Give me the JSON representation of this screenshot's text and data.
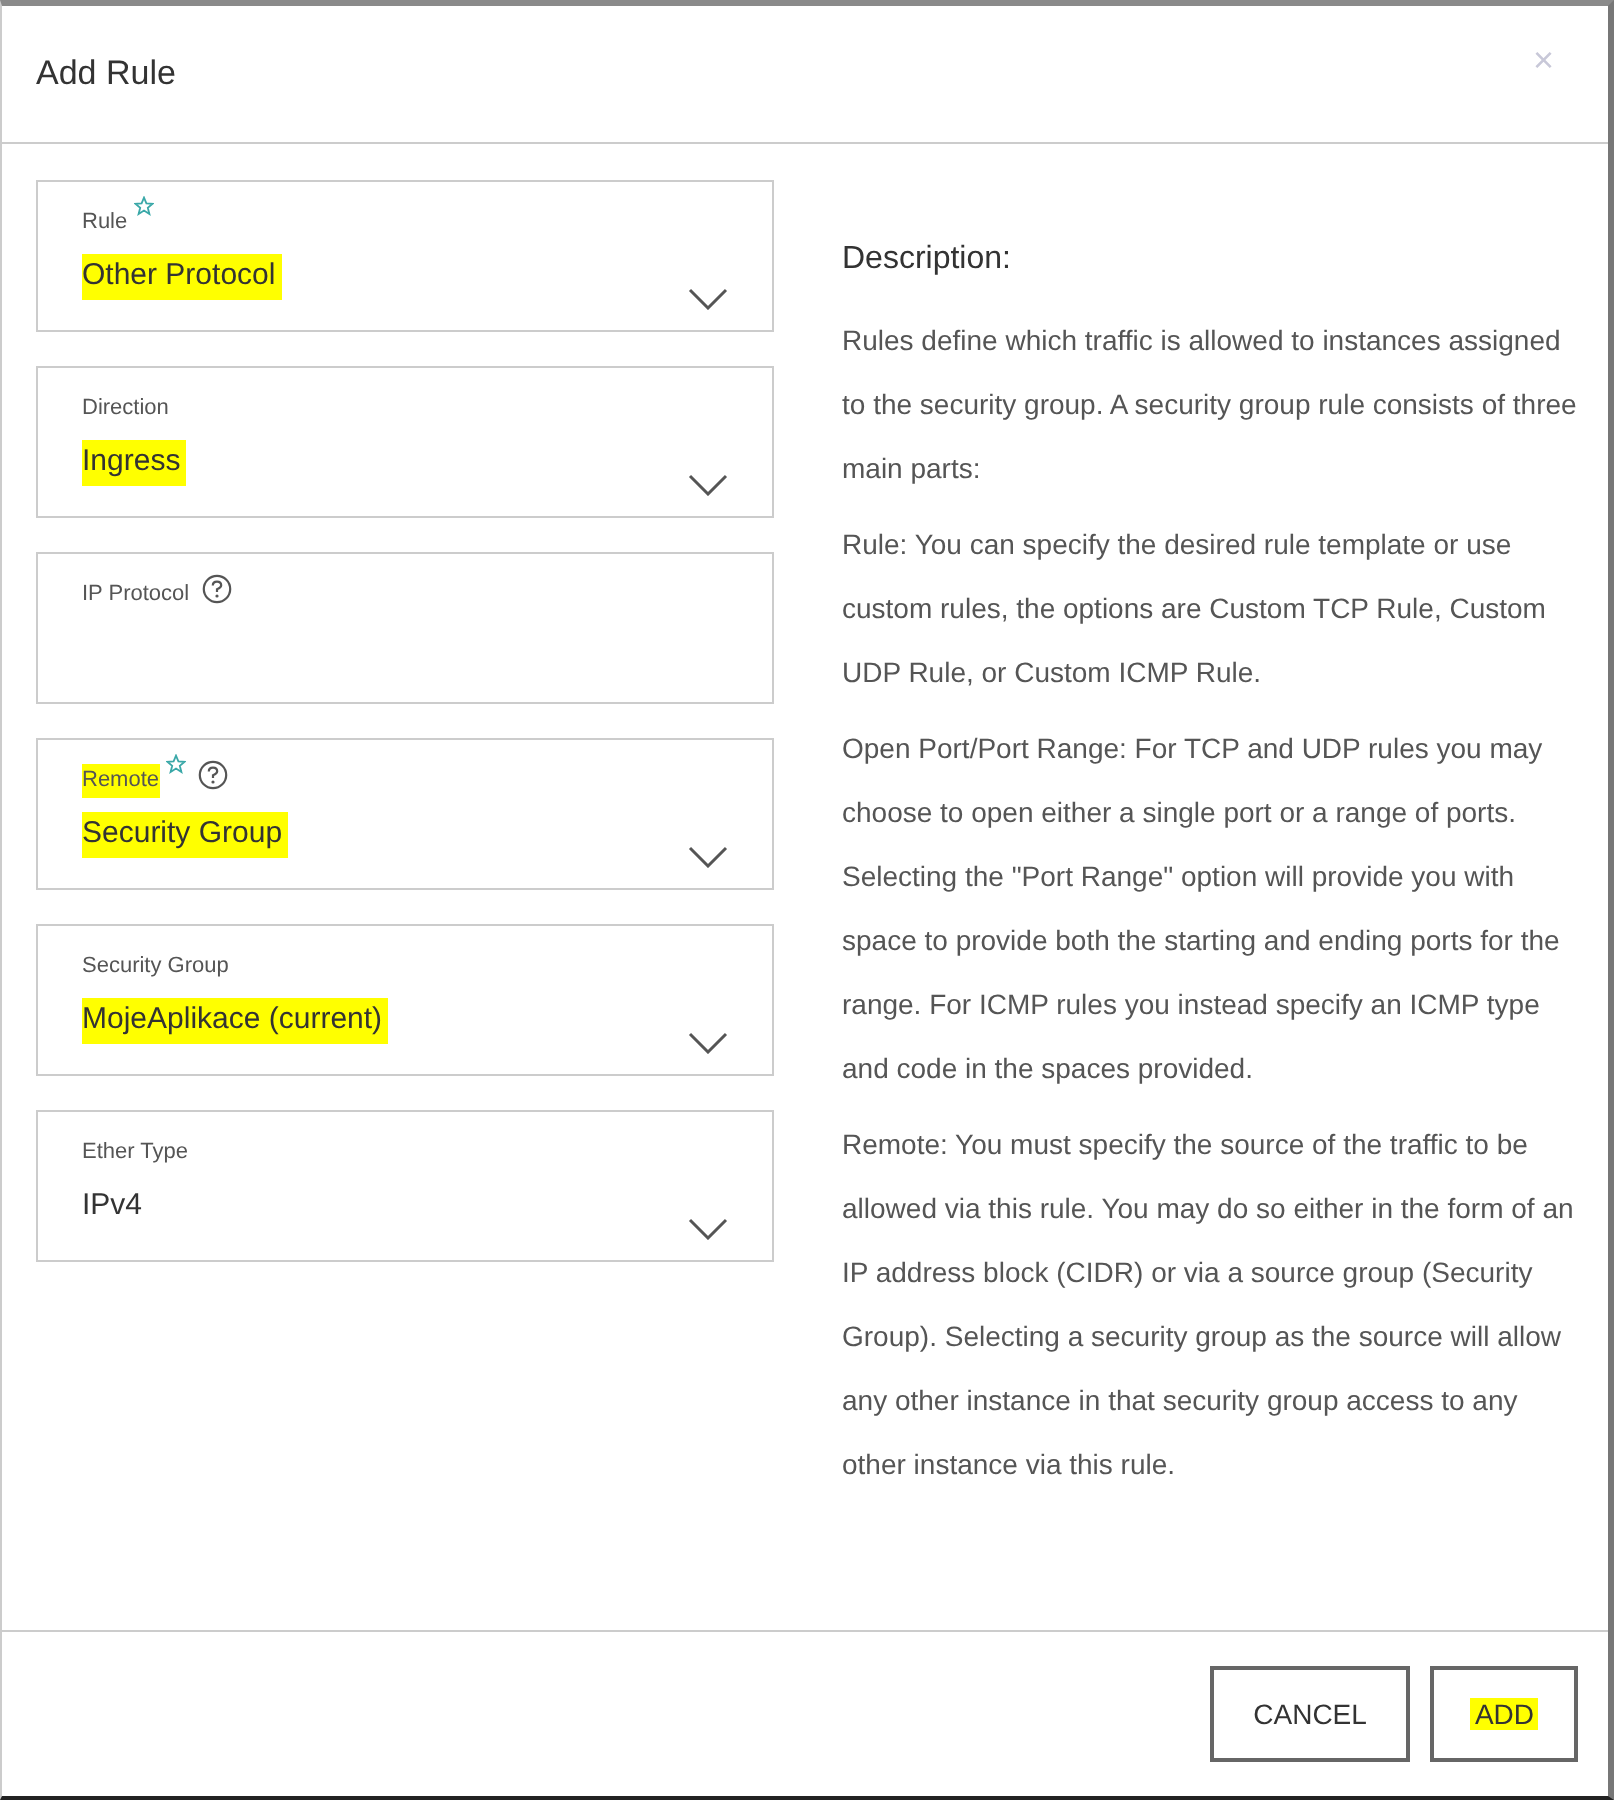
{
  "dialog": {
    "title": "Add Rule",
    "close": "×"
  },
  "fields": [
    {
      "label": "Rule",
      "value": "Other Protocol",
      "required": true,
      "help": false,
      "dropdown": true,
      "label_highlighted": false,
      "value_highlighted": true
    },
    {
      "label": "Direction",
      "value": "Ingress",
      "required": false,
      "help": false,
      "dropdown": true,
      "label_highlighted": false,
      "value_highlighted": true
    },
    {
      "label": "IP Protocol",
      "required": false,
      "help": true,
      "dropdown": false,
      "label_highlighted": false
    },
    {
      "label": "Remote",
      "value": "Security Group",
      "required": true,
      "help": true,
      "dropdown": true,
      "label_highlighted": true,
      "value_highlighted": true
    },
    {
      "label": "Security Group",
      "value": "MojeAplikace (current)",
      "required": false,
      "help": false,
      "dropdown": true,
      "label_highlighted": false,
      "value_highlighted": true
    },
    {
      "label": "Ether Type",
      "value": "IPv4",
      "required": false,
      "help": false,
      "dropdown": true,
      "label_highlighted": false,
      "value_highlighted": false
    }
  ],
  "description": {
    "heading": "Description:",
    "paragraphs": [
      "Rules define which traffic is allowed to instances assigned to the security group. A security group rule consists of three main parts:",
      "Rule: You can specify the desired rule template or use custom rules, the options are Custom TCP Rule, Custom UDP Rule, or Custom ICMP Rule.",
      "Open Port/Port Range: For TCP and UDP rules you may choose to open either a single port or a range of ports. Selecting the \"Port Range\" option will provide you with space to provide both the starting and ending ports for the range. For ICMP rules you instead specify an ICMP type and code in the spaces provided.",
      "Remote: You must specify the source of the traffic to be allowed via this rule. You may do so either in the form of an IP address block (CIDR) or via a source group (Security Group). Selecting a security group as the source will allow any other instance in that security group access to any other instance via this rule."
    ]
  },
  "buttons": [
    {
      "label": "CANCEL",
      "highlighted": false
    },
    {
      "label": "ADD",
      "highlighted": true
    }
  ]
}
